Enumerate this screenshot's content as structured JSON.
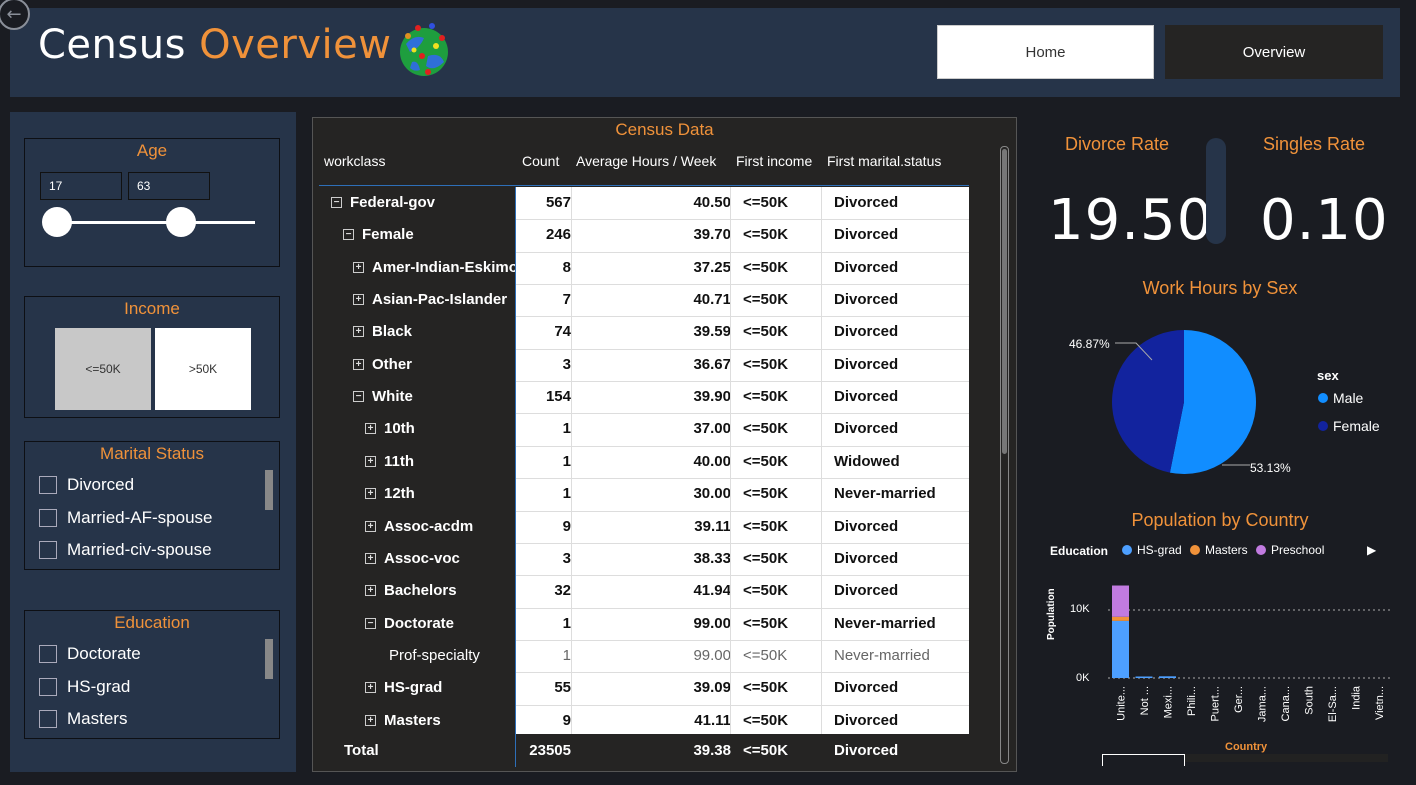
{
  "header": {
    "title_part1": "Census",
    "title_part2": "Overview",
    "home_label": "Home",
    "overview_label": "Overview"
  },
  "filters": {
    "age": {
      "title": "Age",
      "min": "17",
      "max": "63"
    },
    "income": {
      "title": "Income",
      "options": [
        "<=50K",
        ">50K"
      ],
      "selected": "<=50K"
    },
    "marital": {
      "title": "Marital Status",
      "items": [
        "Divorced",
        "Married-AF-spouse",
        "Married-civ-spouse"
      ]
    },
    "education": {
      "title": "Education",
      "items": [
        "Doctorate",
        "HS-grad",
        "Masters"
      ]
    }
  },
  "table": {
    "title": "Census Data",
    "columns": [
      "workclass",
      "Count",
      "Average Hours / Week",
      "First income",
      "First marital.status"
    ],
    "rows": [
      {
        "label": "Federal-gov",
        "expander": "⊟",
        "count": "567",
        "hours": "40.50",
        "income": "<=50K",
        "marital": "Divorced"
      },
      {
        "label": "Female",
        "expander": "⊟",
        "count": "246",
        "hours": "39.70",
        "income": "<=50K",
        "marital": "Divorced"
      },
      {
        "label": "Amer-Indian-Eskimo",
        "expander": "⊞",
        "count": "8",
        "hours": "37.25",
        "income": "<=50K",
        "marital": "Divorced"
      },
      {
        "label": "Asian-Pac-Islander",
        "expander": "⊞",
        "count": "7",
        "hours": "40.71",
        "income": "<=50K",
        "marital": "Divorced"
      },
      {
        "label": "Black",
        "expander": "⊞",
        "count": "74",
        "hours": "39.59",
        "income": "<=50K",
        "marital": "Divorced"
      },
      {
        "label": "Other",
        "expander": "⊞",
        "count": "3",
        "hours": "36.67",
        "income": "<=50K",
        "marital": "Divorced"
      },
      {
        "label": "White",
        "expander": "⊟",
        "count": "154",
        "hours": "39.90",
        "income": "<=50K",
        "marital": "Divorced"
      },
      {
        "label": "10th",
        "expander": "⊞",
        "count": "1",
        "hours": "37.00",
        "income": "<=50K",
        "marital": "Divorced"
      },
      {
        "label": "11th",
        "expander": "⊞",
        "count": "1",
        "hours": "40.00",
        "income": "<=50K",
        "marital": "Widowed"
      },
      {
        "label": "12th",
        "expander": "⊞",
        "count": "1",
        "hours": "30.00",
        "income": "<=50K",
        "marital": "Never-married"
      },
      {
        "label": "Assoc-acdm",
        "expander": "⊞",
        "count": "9",
        "hours": "39.11",
        "income": "<=50K",
        "marital": "Divorced"
      },
      {
        "label": "Assoc-voc",
        "expander": "⊞",
        "count": "3",
        "hours": "38.33",
        "income": "<=50K",
        "marital": "Divorced"
      },
      {
        "label": "Bachelors",
        "expander": "⊞",
        "count": "32",
        "hours": "41.94",
        "income": "<=50K",
        "marital": "Divorced"
      },
      {
        "label": "Doctorate",
        "expander": "⊟",
        "count": "1",
        "hours": "99.00",
        "income": "<=50K",
        "marital": "Never-married"
      },
      {
        "label": "Prof-specialty",
        "expander": "",
        "count": "1",
        "hours": "99.00",
        "income": "<=50K",
        "marital": "Never-married"
      },
      {
        "label": "HS-grad",
        "expander": "⊞",
        "count": "55",
        "hours": "39.09",
        "income": "<=50K",
        "marital": "Divorced"
      },
      {
        "label": "Masters",
        "expander": "⊞",
        "count": "9",
        "hours": "41.11",
        "income": "<=50K",
        "marital": "Divorced"
      }
    ],
    "total": {
      "label": "Total",
      "count": "23505",
      "hours": "39.38",
      "income": "<=50K",
      "marital": "Divorced"
    }
  },
  "kpis": {
    "divorce": {
      "title": "Divorce Rate",
      "value": "19.50"
    },
    "singles": {
      "title": "Singles Rate",
      "value": "0.10"
    }
  },
  "pie": {
    "title": "Work Hours by Sex",
    "legend_title": "sex",
    "label_female": "46.87%",
    "label_male": "53.13%"
  },
  "bar": {
    "title": "Population by Country",
    "legend_title": "Education",
    "y_axis_label": "Population",
    "x_axis_label": "Country",
    "y_ticks": [
      "10K",
      "0K"
    ],
    "x_labels": [
      "Unite...",
      "Not ...",
      "Mexi...",
      "Phili...",
      "Puert...",
      "Ger...",
      "Jama...",
      "Cana...",
      "South",
      "El-Sa...",
      "India",
      "Vietn..."
    ]
  },
  "colors": {
    "accent": "#f0923a",
    "male": "#118dff",
    "female": "#12239e",
    "hs_grad": "#4d9fff",
    "masters": "#f0923a",
    "preschool": "#c17be0",
    "panel": "#263449"
  },
  "chart_data": [
    {
      "type": "pie",
      "title": "Work Hours by Sex",
      "legend_title": "sex",
      "slices": [
        {
          "name": "Male",
          "value": 53.13,
          "color": "#118dff"
        },
        {
          "name": "Female",
          "value": 46.87,
          "color": "#12239e"
        }
      ]
    },
    {
      "type": "bar",
      "title": "Population by Country",
      "xlabel": "Country",
      "ylabel": "Population",
      "categories": [
        "Unite...",
        "Not ...",
        "Mexi...",
        "Phili...",
        "Puert...",
        "Ger...",
        "Jama...",
        "Cana...",
        "South",
        "El-Sa...",
        "India",
        "Vietn..."
      ],
      "series": [
        {
          "name": "HS-grad",
          "color": "#4d9fff",
          "values": [
            8400,
            200,
            250,
            0,
            0,
            0,
            0,
            0,
            0,
            0,
            0,
            0
          ]
        },
        {
          "name": "Masters",
          "color": "#f0923a",
          "values": [
            600,
            0,
            0,
            0,
            0,
            0,
            0,
            0,
            0,
            0,
            0,
            0
          ]
        },
        {
          "name": "Preschool",
          "color": "#c17be0",
          "values": [
            4600,
            0,
            0,
            0,
            0,
            0,
            0,
            0,
            0,
            0,
            0,
            0
          ]
        }
      ],
      "stacked": true,
      "ylim": [
        0,
        14000
      ],
      "legend_position": "top"
    }
  ]
}
